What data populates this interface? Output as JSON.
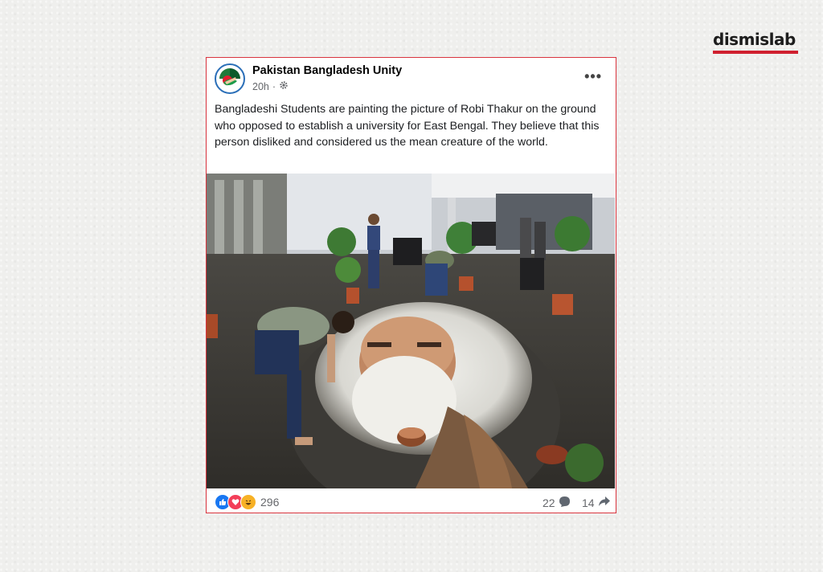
{
  "brand": {
    "name": "dismislab",
    "bar_color": "#d0202f"
  },
  "post": {
    "page_name": "Pakistan Bangladesh Unity",
    "time": "20h",
    "separator": "·",
    "audience_icon": "settings-gear-icon",
    "more_label": "•••",
    "caption": "Bangladeshi Students are painting the picture of Robi Thakur on the ground who opposed to establish a university for East Bengal. They believe that this person disliked and considered us the mean creature of the world.",
    "border_color": "#d9343e",
    "image_icon": "street-chalk-portrait-photo"
  },
  "footer": {
    "reaction_icons": [
      "like-icon",
      "love-icon",
      "haha-icon"
    ],
    "reaction_count": "296",
    "comment_count": "22",
    "comment_icon": "comment-bubble-icon",
    "share_count": "14",
    "share_icon": "share-arrow-icon"
  }
}
